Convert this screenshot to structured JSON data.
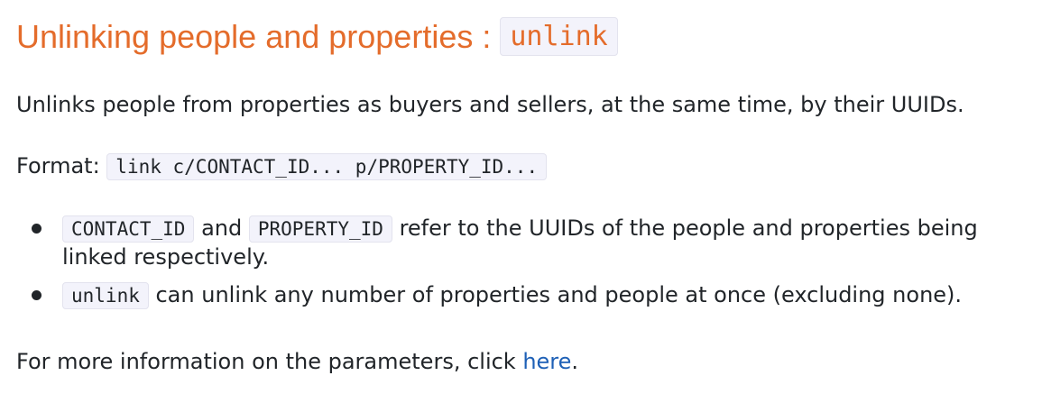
{
  "heading": {
    "text": "Unlinking people and properties : ",
    "command": "unlink"
  },
  "description": "Unlinks people from properties as buyers and sellers, at the same time, by their UUIDs.",
  "format": {
    "label": "Format: ",
    "syntax": "link c/CONTACT_ID... p/PROPERTY_ID..."
  },
  "bullets": [
    {
      "code1": "CONTACT_ID",
      "text1": " and ",
      "code2": "PROPERTY_ID",
      "text2": " refer to the UUIDs of the people and properties being",
      "text3": "linked respectively."
    },
    {
      "code1": "unlink",
      "text1": " can unlink any number of properties and people at once (excluding none)."
    }
  ],
  "more_info": {
    "text": "For more information on the parameters, click ",
    "link": "here",
    "suffix": "."
  },
  "colors": {
    "heading": "#e46c2b",
    "link": "#1e60b6",
    "code_bg": "#f3f3fb"
  }
}
